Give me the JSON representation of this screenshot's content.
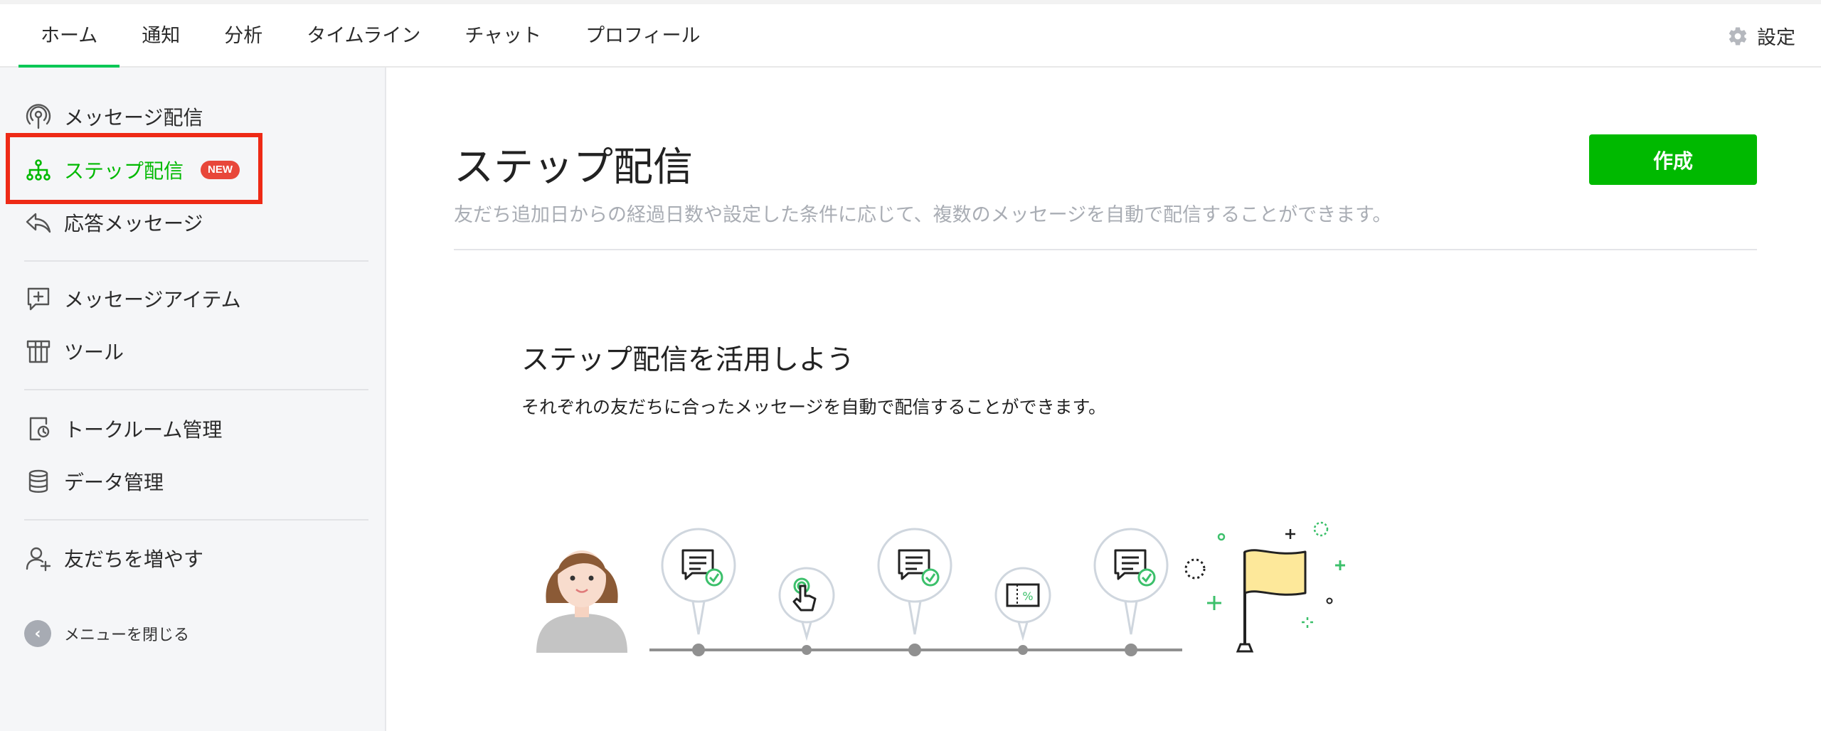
{
  "topnav": {
    "tabs": [
      {
        "label": "ホーム",
        "active": true
      },
      {
        "label": "通知",
        "active": false
      },
      {
        "label": "分析",
        "active": false
      },
      {
        "label": "タイムライン",
        "active": false
      },
      {
        "label": "チャット",
        "active": false
      },
      {
        "label": "プロフィール",
        "active": false
      }
    ],
    "settings_label": "設定"
  },
  "sidebar": {
    "items": [
      {
        "label": "メッセージ配信",
        "icon": "broadcast-icon"
      },
      {
        "label": "ステップ配信",
        "icon": "step-tree-icon",
        "badge": "NEW",
        "active": true,
        "highlighted": true
      },
      {
        "label": "応答メッセージ",
        "icon": "reply-icon"
      },
      {
        "label": "メッセージアイテム",
        "icon": "message-plus-icon"
      },
      {
        "label": "ツール",
        "icon": "gift-box-icon"
      },
      {
        "label": "トークルーム管理",
        "icon": "phone-settings-icon"
      },
      {
        "label": "データ管理",
        "icon": "database-icon"
      },
      {
        "label": "友だちを増やす",
        "icon": "add-friend-icon"
      }
    ],
    "close_menu_label": "メニューを閉じる"
  },
  "main": {
    "title": "ステップ配信",
    "description": "友だち追加日からの経過日数や設定した条件に応じて、複数のメッセージを自動で配信することができます。",
    "create_button": "作成",
    "promo": {
      "title": "ステップ配信を活用しよう",
      "description": "それぞれの友だちに合ったメッセージを自動で配信することができます。"
    }
  },
  "colors": {
    "brand_green": "#00b900",
    "highlight_red": "#ee2a16",
    "badge_red": "#e8473a"
  }
}
